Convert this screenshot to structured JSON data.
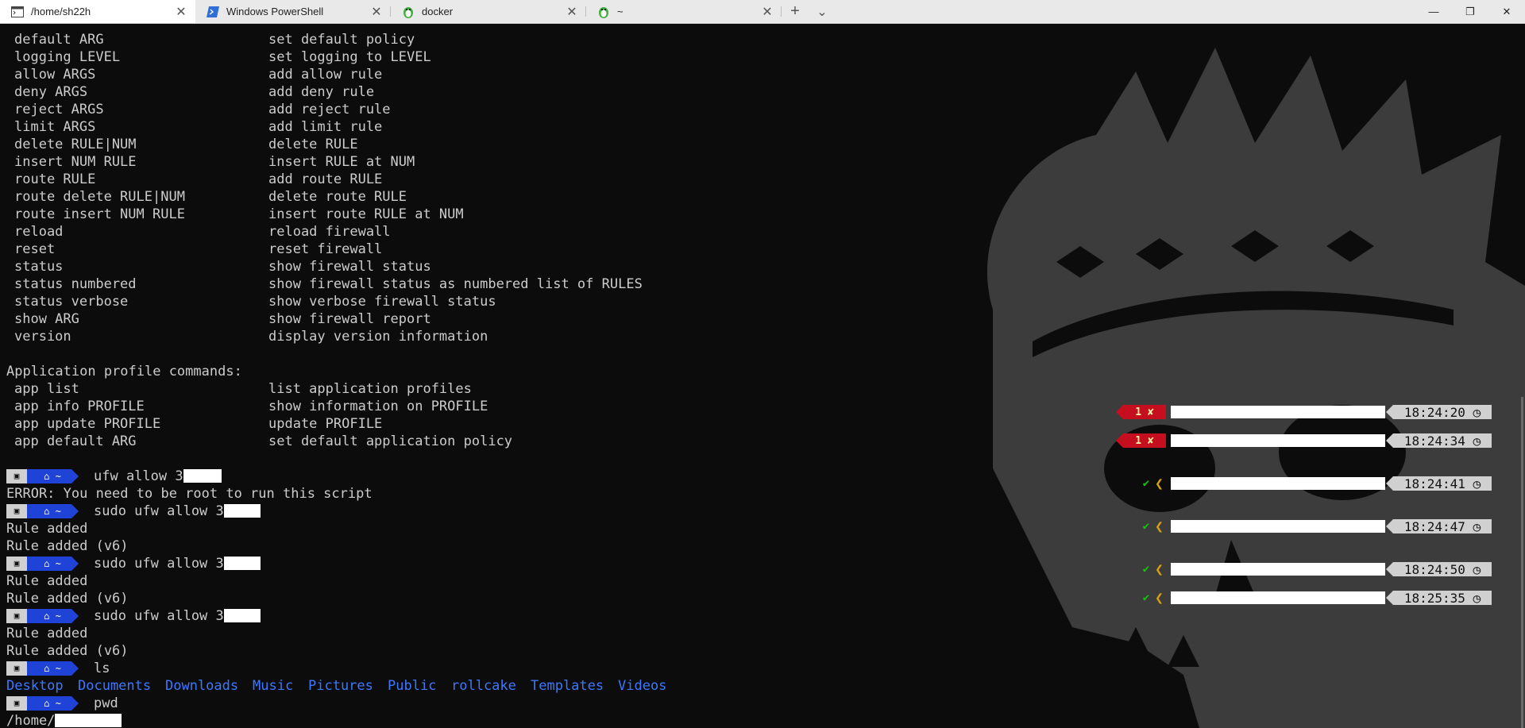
{
  "tabs": [
    {
      "title": "/home/sh22h",
      "icon": "terminal-icon",
      "active": true
    },
    {
      "title": "Windows PowerShell",
      "icon": "powershell-icon",
      "active": false
    },
    {
      "title": "docker",
      "icon": "linux-penguin-icon",
      "active": false
    },
    {
      "title": "~",
      "icon": "linux-penguin-icon",
      "active": false
    }
  ],
  "window_controls": {
    "minimize": "—",
    "maximize": "❐",
    "close": "✕",
    "new_tab": "+",
    "dropdown": "⌄"
  },
  "help_commands": [
    {
      "cmd": "default ARG",
      "desc": "set default policy"
    },
    {
      "cmd": "logging LEVEL",
      "desc": "set logging to LEVEL"
    },
    {
      "cmd": "allow ARGS",
      "desc": "add allow rule"
    },
    {
      "cmd": "deny ARGS",
      "desc": "add deny rule"
    },
    {
      "cmd": "reject ARGS",
      "desc": "add reject rule"
    },
    {
      "cmd": "limit ARGS",
      "desc": "add limit rule"
    },
    {
      "cmd": "delete RULE|NUM",
      "desc": "delete RULE"
    },
    {
      "cmd": "insert NUM RULE",
      "desc": "insert RULE at NUM"
    },
    {
      "cmd": "route RULE",
      "desc": "add route RULE"
    },
    {
      "cmd": "route delete RULE|NUM",
      "desc": "delete route RULE"
    },
    {
      "cmd": "route insert NUM RULE",
      "desc": "insert route RULE at NUM"
    },
    {
      "cmd": "reload",
      "desc": "reload firewall"
    },
    {
      "cmd": "reset",
      "desc": "reset firewall"
    },
    {
      "cmd": "status",
      "desc": "show firewall status"
    },
    {
      "cmd": "status numbered",
      "desc": "show firewall status as numbered list of RULES"
    },
    {
      "cmd": "status verbose",
      "desc": "show verbose firewall status"
    },
    {
      "cmd": "show ARG",
      "desc": "show firewall report"
    },
    {
      "cmd": "version",
      "desc": "display version information"
    }
  ],
  "app_section_title": "Application profile commands:",
  "app_commands": [
    {
      "cmd": "app list",
      "desc": "list application profiles"
    },
    {
      "cmd": "app info PROFILE",
      "desc": "show information on PROFILE"
    },
    {
      "cmd": "app update PROFILE",
      "desc": "update PROFILE"
    },
    {
      "cmd": "app default ARG",
      "desc": "set default application policy"
    }
  ],
  "prompt": {
    "dir": "~"
  },
  "session": [
    {
      "command": "ufw allow 3",
      "status": "error",
      "exit_code": "1 ✘",
      "time": "18:24:20",
      "output": [
        "ERROR: You need to be root to run this script"
      ]
    },
    {
      "command": "sudo ufw allow 3",
      "status": "error",
      "exit_code": "1 ✘",
      "time": "18:24:34",
      "output": [
        "Rule added",
        "Rule added (v6)"
      ]
    },
    {
      "command": "sudo ufw allow 3",
      "status": "ok",
      "exit_code": "✔",
      "time": "18:24:41",
      "output": [
        "Rule added",
        "Rule added (v6)"
      ]
    },
    {
      "command": "sudo ufw allow 3",
      "status": "ok",
      "exit_code": "✔",
      "time": "18:24:47",
      "output": [
        "Rule added",
        "Rule added (v6)"
      ]
    },
    {
      "command": "ls",
      "status": "ok",
      "exit_code": "✔",
      "time": "18:24:50",
      "ls_output": [
        "Desktop",
        "Documents",
        "Downloads",
        "Music",
        "Pictures",
        "Public",
        "rollcake",
        "Templates",
        "Videos"
      ]
    },
    {
      "command": "pwd",
      "status": "ok",
      "exit_code": "✔",
      "time": "18:25:35",
      "output": [
        "/home/"
      ]
    }
  ],
  "colors": {
    "prompt_dir_bg": "#1f43d6",
    "prompt_os_bg": "#d0d0d0",
    "error_bg": "#c50f1f",
    "ok": "#16c60c",
    "ls_dir": "#3b78ff"
  }
}
